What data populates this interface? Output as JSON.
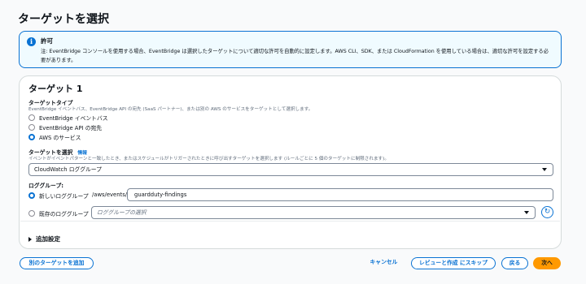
{
  "page": {
    "title": "ターゲットを選択"
  },
  "info": {
    "title": "許可",
    "text": "注: EventBridge コンソールを使用する場合、EventBridge は選択したターゲットについて適切な許可を自動的に設定します。AWS CLI、SDK、または CloudFormation を使用している場合は、適切な許可を設定する必要があります。"
  },
  "target": {
    "title": "ターゲット 1",
    "type_label": "ターゲットタイプ",
    "type_desc": "EventBridge イベントバス、EventBridge API の宛先 (SaaS パートナー)、または別の AWS のサービスをターゲットとして選択します。",
    "types": [
      {
        "label": "EventBridge イベントバス",
        "checked": false
      },
      {
        "label": "EventBridge API の宛先",
        "checked": false
      },
      {
        "label": "AWS のサービス",
        "checked": true
      }
    ],
    "select_label": "ターゲットを選択",
    "select_info": "情報",
    "select_desc": "イベントがイベントパターンと一致したとき、またはスケジュールがトリガーされたときに呼び出すターゲットを選択します (ルールごとに 5 個のターゲットに制限されます)。",
    "select_value": "CloudWatch ロググループ",
    "log_group_label": "ロググループ:",
    "new_log_group_label": "新しいロググループ",
    "log_prefix": "/aws/events/",
    "log_name_value": "guardduty-findings",
    "existing_log_group_label": "既存のロググループ",
    "existing_placeholder": "ロググループの選択",
    "additional_settings": "追加設定"
  },
  "actions": {
    "add_target": "別のターゲットを追加",
    "cancel": "キャンセル",
    "skip_to_review": "レビューと作成 にスキップ",
    "back": "戻る",
    "next": "次へ"
  },
  "colors": {
    "accent": "#0972d3",
    "primary_button": "#ff9900",
    "info_bg": "#f0fbff"
  }
}
